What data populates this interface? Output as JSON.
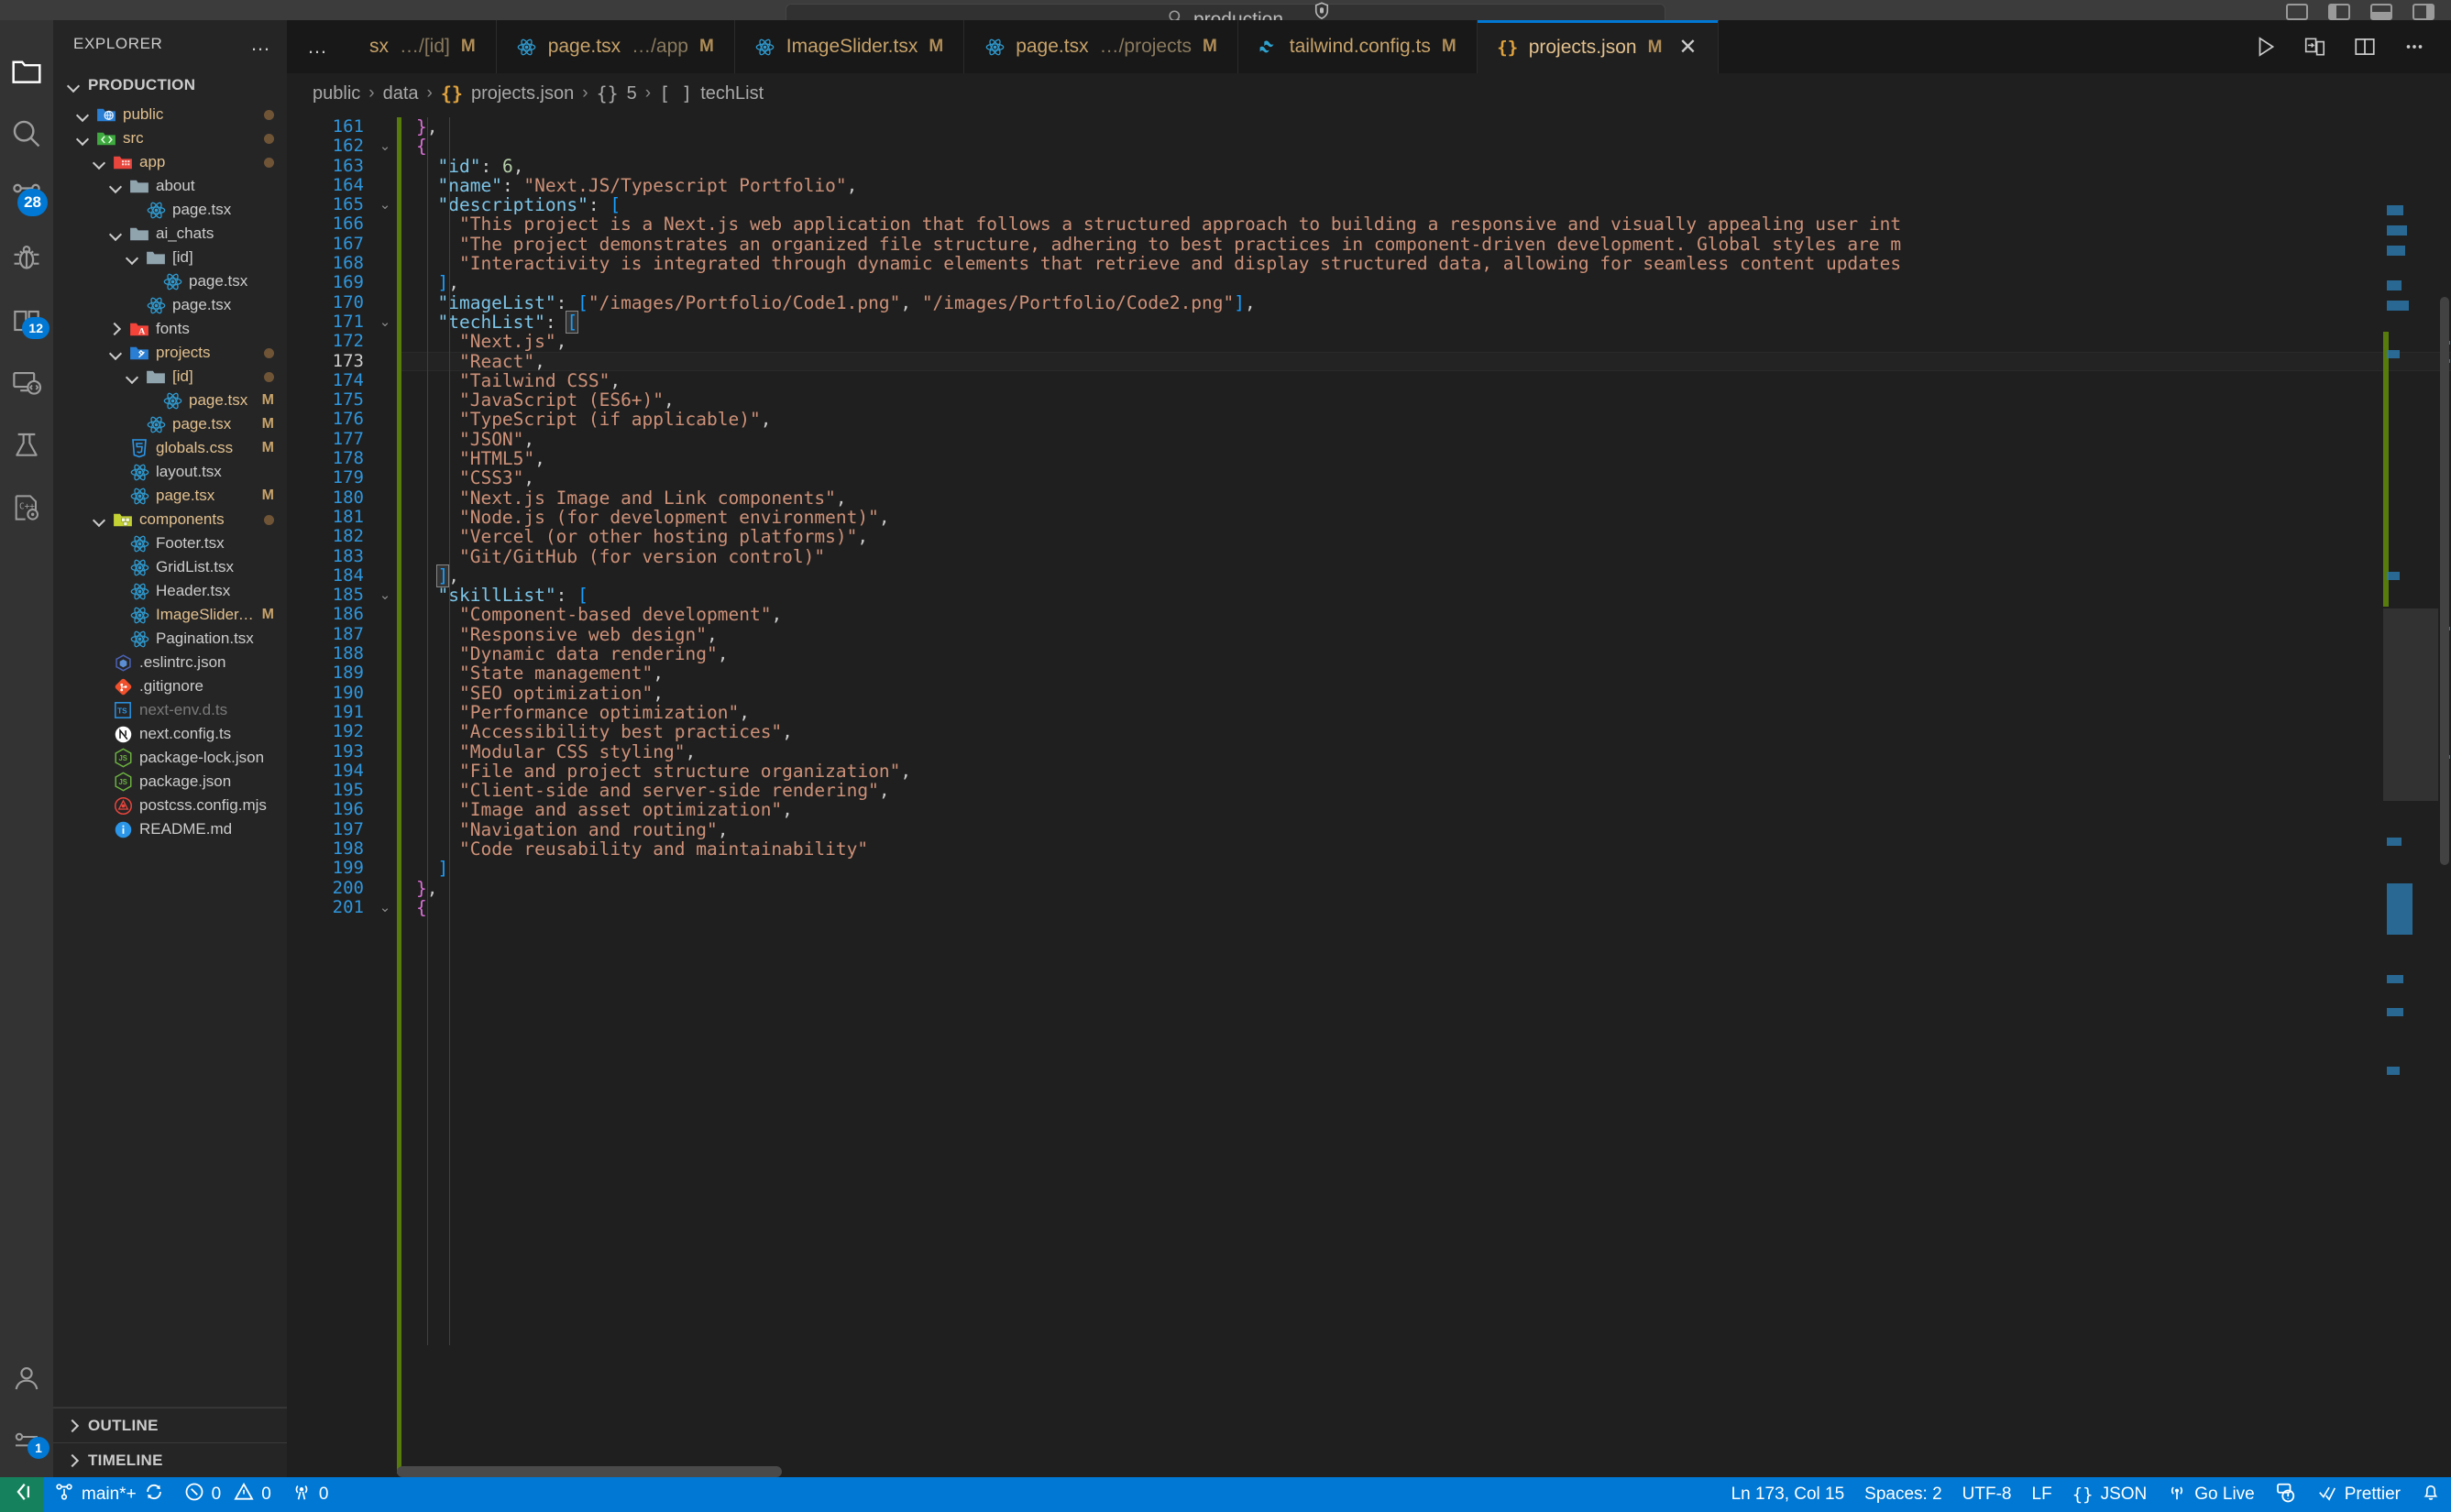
{
  "titlebar": {
    "search_value": "production",
    "search_icon": "search-icon",
    "shield_icon": "shield-icon",
    "window_controls": [
      "split-editor-icon",
      "panel-left-icon",
      "panel-bottom-icon",
      "panel-right-icon"
    ]
  },
  "activitybar": {
    "items": [
      {
        "name": "explorer",
        "icon": "files-explorer-icon",
        "badge": ""
      },
      {
        "name": "search",
        "icon": "search-icon",
        "badge": ""
      },
      {
        "name": "source-control",
        "icon": "source-control-icon",
        "badge": "28"
      },
      {
        "name": "run-and-debug",
        "icon": "debug-icon",
        "badge": ""
      },
      {
        "name": "extensions",
        "icon": "extensions-icon",
        "badge": "12"
      },
      {
        "name": "remote-explorer",
        "icon": "remote-explorer-icon",
        "badge": ""
      },
      {
        "name": "testing",
        "icon": "beaker-icon",
        "badge": ""
      },
      {
        "name": "cpp-config",
        "icon": "cpp-gear-icon",
        "badge": ""
      }
    ],
    "bottom": [
      {
        "name": "accounts",
        "icon": "account-icon",
        "badge": ""
      },
      {
        "name": "manage",
        "icon": "gear-icon",
        "badge": "1"
      }
    ]
  },
  "sidebar": {
    "title": "EXPLORER",
    "more_actions": "…",
    "root_section": "PRODUCTION",
    "tree": [
      {
        "label": "public",
        "indent": 1,
        "type": "folder",
        "icon": "folder-public-icon",
        "arrow": "down",
        "status": "",
        "dot": true,
        "color": "mod"
      },
      {
        "label": "src",
        "indent": 1,
        "type": "folder",
        "icon": "folder-src-icon",
        "arrow": "down",
        "status": "",
        "dot": true,
        "color": "mod"
      },
      {
        "label": "app",
        "indent": 2,
        "type": "folder",
        "icon": "folder-app-icon",
        "arrow": "down",
        "status": "",
        "dot": true,
        "color": "mod"
      },
      {
        "label": "about",
        "indent": 3,
        "type": "folder",
        "icon": "folder-icon",
        "arrow": "down",
        "status": "",
        "dot": false,
        "color": ""
      },
      {
        "label": "page.tsx",
        "indent": 4,
        "type": "file",
        "icon": "react-icon",
        "arrow": "",
        "status": "",
        "dot": false,
        "color": ""
      },
      {
        "label": "ai_chats",
        "indent": 3,
        "type": "folder",
        "icon": "folder-icon",
        "arrow": "down",
        "status": "",
        "dot": false,
        "color": ""
      },
      {
        "label": "[id]",
        "indent": 4,
        "type": "folder",
        "icon": "folder-icon",
        "arrow": "down",
        "status": "",
        "dot": false,
        "color": ""
      },
      {
        "label": "page.tsx",
        "indent": 5,
        "type": "file",
        "icon": "react-icon",
        "arrow": "",
        "status": "",
        "dot": false,
        "color": ""
      },
      {
        "label": "page.tsx",
        "indent": 4,
        "type": "file",
        "icon": "react-icon",
        "arrow": "",
        "status": "",
        "dot": false,
        "color": ""
      },
      {
        "label": "fonts",
        "indent": 3,
        "type": "folder",
        "icon": "folder-fonts-icon",
        "arrow": "right",
        "status": "",
        "dot": false,
        "color": ""
      },
      {
        "label": "projects",
        "indent": 3,
        "type": "folder",
        "icon": "folder-projects-icon",
        "arrow": "down",
        "status": "",
        "dot": true,
        "color": "mod"
      },
      {
        "label": "[id]",
        "indent": 4,
        "type": "folder",
        "icon": "folder-icon",
        "arrow": "down",
        "status": "",
        "dot": true,
        "color": "mod"
      },
      {
        "label": "page.tsx",
        "indent": 5,
        "type": "file",
        "icon": "react-icon",
        "arrow": "",
        "status": "M",
        "dot": false,
        "color": "mod"
      },
      {
        "label": "page.tsx",
        "indent": 4,
        "type": "file",
        "icon": "react-icon",
        "arrow": "",
        "status": "M",
        "dot": false,
        "color": "mod"
      },
      {
        "label": "globals.css",
        "indent": 3,
        "type": "file",
        "icon": "css-icon",
        "arrow": "",
        "status": "M",
        "dot": false,
        "color": "mod"
      },
      {
        "label": "layout.tsx",
        "indent": 3,
        "type": "file",
        "icon": "react-icon",
        "arrow": "",
        "status": "",
        "dot": false,
        "color": ""
      },
      {
        "label": "page.tsx",
        "indent": 3,
        "type": "file",
        "icon": "react-icon",
        "arrow": "",
        "status": "M",
        "dot": false,
        "color": "mod"
      },
      {
        "label": "components",
        "indent": 2,
        "type": "folder",
        "icon": "folder-components-icon",
        "arrow": "down",
        "status": "",
        "dot": true,
        "color": "mod"
      },
      {
        "label": "Footer.tsx",
        "indent": 3,
        "type": "file",
        "icon": "react-icon",
        "arrow": "",
        "status": "",
        "dot": false,
        "color": ""
      },
      {
        "label": "GridList.tsx",
        "indent": 3,
        "type": "file",
        "icon": "react-icon",
        "arrow": "",
        "status": "",
        "dot": false,
        "color": ""
      },
      {
        "label": "Header.tsx",
        "indent": 3,
        "type": "file",
        "icon": "react-icon",
        "arrow": "",
        "status": "",
        "dot": false,
        "color": ""
      },
      {
        "label": "ImageSlider.tsx",
        "indent": 3,
        "type": "file",
        "icon": "react-icon",
        "arrow": "",
        "status": "M",
        "dot": false,
        "color": "mod"
      },
      {
        "label": "Pagination.tsx",
        "indent": 3,
        "type": "file",
        "icon": "react-icon",
        "arrow": "",
        "status": "",
        "dot": false,
        "color": ""
      },
      {
        "label": ".eslintrc.json",
        "indent": 2,
        "type": "file",
        "icon": "eslint-icon",
        "arrow": "",
        "status": "",
        "dot": false,
        "color": ""
      },
      {
        "label": ".gitignore",
        "indent": 2,
        "type": "file",
        "icon": "git-icon",
        "arrow": "",
        "status": "",
        "dot": false,
        "color": ""
      },
      {
        "label": "next-env.d.ts",
        "indent": 2,
        "type": "file",
        "icon": "typescript-def-icon",
        "arrow": "",
        "status": "",
        "dot": false,
        "color": "dim"
      },
      {
        "label": "next.config.ts",
        "indent": 2,
        "type": "file",
        "icon": "nextjs-icon",
        "arrow": "",
        "status": "",
        "dot": false,
        "color": ""
      },
      {
        "label": "package-lock.json",
        "indent": 2,
        "type": "file",
        "icon": "npm-json-icon",
        "arrow": "",
        "status": "",
        "dot": false,
        "color": ""
      },
      {
        "label": "package.json",
        "indent": 2,
        "type": "file",
        "icon": "npm-json-icon",
        "arrow": "",
        "status": "",
        "dot": false,
        "color": ""
      },
      {
        "label": "postcss.config.mjs",
        "indent": 2,
        "type": "file",
        "icon": "postcss-icon",
        "arrow": "",
        "status": "",
        "dot": false,
        "color": ""
      },
      {
        "label": "README.md",
        "indent": 2,
        "type": "file",
        "icon": "info-markdown-icon",
        "arrow": "",
        "status": "",
        "dot": false,
        "color": ""
      }
    ],
    "footer_sections": [
      "OUTLINE",
      "TIMELINE"
    ]
  },
  "tabs": {
    "leading_overflow": "…",
    "items": [
      {
        "label": "sx",
        "sub": "…/[id]",
        "status": "M",
        "icon": "",
        "active": false,
        "clipped": true
      },
      {
        "label": "page.tsx",
        "sub": "…/app",
        "status": "M",
        "icon": "react-icon",
        "active": false,
        "clipped": false
      },
      {
        "label": "ImageSlider.tsx",
        "sub": "",
        "status": "M",
        "icon": "react-icon",
        "active": false,
        "clipped": false
      },
      {
        "label": "page.tsx",
        "sub": "…/projects",
        "status": "M",
        "icon": "react-icon",
        "active": false,
        "clipped": false
      },
      {
        "label": "tailwind.config.ts",
        "sub": "",
        "status": "M",
        "icon": "tailwind-icon",
        "active": false,
        "clipped": false
      },
      {
        "label": "projects.json",
        "sub": "",
        "status": "M",
        "icon": "json-icon",
        "active": true,
        "clipped": false
      }
    ],
    "actions": [
      "run-play-icon",
      "split-run-icon",
      "split-editor-icon",
      "more-actions-icon"
    ]
  },
  "breadcrumb": {
    "parts": [
      {
        "text": "public",
        "icon": ""
      },
      {
        "text": "data",
        "icon": ""
      },
      {
        "text": "projects.json",
        "icon": "json-icon"
      },
      {
        "text": "5",
        "icon": "object-icon"
      },
      {
        "text": "techList",
        "icon": "array-icon"
      }
    ],
    "separator": "›"
  },
  "code": {
    "first_line_number": 161,
    "language": "JSON",
    "current_line": 173,
    "lines": [
      {
        "n": 161,
        "fold": "",
        "indentGuides": 0,
        "html": "<span class=\"brc\">}</span><span class=\"p\">,</span>"
      },
      {
        "n": 162,
        "fold": "v",
        "indentGuides": 0,
        "html": "<span class=\"brc\">{</span>"
      },
      {
        "n": 163,
        "fold": "",
        "indentGuides": 1,
        "html": "  <span class=\"k\">\"id\"</span><span class=\"p\">: </span><span class=\"n\">6</span><span class=\"p\">,</span>"
      },
      {
        "n": 164,
        "fold": "",
        "indentGuides": 1,
        "html": "  <span class=\"k\">\"name\"</span><span class=\"p\">: </span><span class=\"s\">\"Next.JS/Typescript Portfolio\"</span><span class=\"p\">,</span>"
      },
      {
        "n": 165,
        "fold": "v",
        "indentGuides": 1,
        "html": "  <span class=\"k\">\"descriptions\"</span><span class=\"p\">: </span><span class=\"brs\">[</span>"
      },
      {
        "n": 166,
        "fold": "",
        "indentGuides": 2,
        "html": "    <span class=\"s\">\"This project is a Next.js web application that follows a structured approach to building a responsive and visually appealing user int</span>"
      },
      {
        "n": 167,
        "fold": "",
        "indentGuides": 2,
        "html": "    <span class=\"s\">\"The project demonstrates an organized file structure, adhering to best practices in component-driven development. Global styles are m</span>"
      },
      {
        "n": 168,
        "fold": "",
        "indentGuides": 2,
        "html": "    <span class=\"s\">\"Interactivity is integrated through dynamic elements that retrieve and display structured data, allowing for seamless content updates</span>"
      },
      {
        "n": 169,
        "fold": "",
        "indentGuides": 1,
        "html": "  <span class=\"brs\">]</span><span class=\"p\">,</span>"
      },
      {
        "n": 170,
        "fold": "",
        "indentGuides": 1,
        "html": "  <span class=\"k\">\"imageList\"</span><span class=\"p\">: </span><span class=\"brs\">[</span><span class=\"s\">\"/images/Portfolio/Code1.png\"</span><span class=\"p\">, </span><span class=\"s\">\"/images/Portfolio/Code2.png\"</span><span class=\"brs\">]</span><span class=\"p\">,</span>"
      },
      {
        "n": 171,
        "fold": "v",
        "indentGuides": 1,
        "html": "  <span class=\"k\">\"techList\"</span><span class=\"p\">: </span><span class=\"brs match\">[</span>"
      },
      {
        "n": 172,
        "fold": "",
        "indentGuides": 2,
        "html": "    <span class=\"s\">\"Next.js\"</span><span class=\"p\">,</span>"
      },
      {
        "n": 173,
        "fold": "",
        "indentGuides": 2,
        "html": "    <span class=\"s\">\"React\"</span><span class=\"p\">,</span>"
      },
      {
        "n": 174,
        "fold": "",
        "indentGuides": 2,
        "html": "    <span class=\"s\">\"Tailwind CSS\"</span><span class=\"p\">,</span>"
      },
      {
        "n": 175,
        "fold": "",
        "indentGuides": 2,
        "html": "    <span class=\"s\">\"JavaScript (ES6+)\"</span><span class=\"p\">,</span>"
      },
      {
        "n": 176,
        "fold": "",
        "indentGuides": 2,
        "html": "    <span class=\"s\">\"TypeScript (if applicable)\"</span><span class=\"p\">,</span>"
      },
      {
        "n": 177,
        "fold": "",
        "indentGuides": 2,
        "html": "    <span class=\"s\">\"JSON\"</span><span class=\"p\">,</span>"
      },
      {
        "n": 178,
        "fold": "",
        "indentGuides": 2,
        "html": "    <span class=\"s\">\"HTML5\"</span><span class=\"p\">,</span>"
      },
      {
        "n": 179,
        "fold": "",
        "indentGuides": 2,
        "html": "    <span class=\"s\">\"CSS3\"</span><span class=\"p\">,</span>"
      },
      {
        "n": 180,
        "fold": "",
        "indentGuides": 2,
        "html": "    <span class=\"s\">\"Next.js Image and Link components\"</span><span class=\"p\">,</span>"
      },
      {
        "n": 181,
        "fold": "",
        "indentGuides": 2,
        "html": "    <span class=\"s\">\"Node.js (for development environment)\"</span><span class=\"p\">,</span>"
      },
      {
        "n": 182,
        "fold": "",
        "indentGuides": 2,
        "html": "    <span class=\"s\">\"Vercel (or other hosting platforms)\"</span><span class=\"p\">,</span>"
      },
      {
        "n": 183,
        "fold": "",
        "indentGuides": 2,
        "html": "    <span class=\"s\">\"Git/GitHub (for version control)\"</span>"
      },
      {
        "n": 184,
        "fold": "",
        "indentGuides": 1,
        "html": "  <span class=\"brs match\">]</span><span class=\"p\">,</span>"
      },
      {
        "n": 185,
        "fold": "v",
        "indentGuides": 1,
        "html": "  <span class=\"k\">\"skillList\"</span><span class=\"p\">: </span><span class=\"brs\">[</span>"
      },
      {
        "n": 186,
        "fold": "",
        "indentGuides": 2,
        "html": "    <span class=\"s\">\"Component-based development\"</span><span class=\"p\">,</span>"
      },
      {
        "n": 187,
        "fold": "",
        "indentGuides": 2,
        "html": "    <span class=\"s\">\"Responsive web design\"</span><span class=\"p\">,</span>"
      },
      {
        "n": 188,
        "fold": "",
        "indentGuides": 2,
        "html": "    <span class=\"s\">\"Dynamic data rendering\"</span><span class=\"p\">,</span>"
      },
      {
        "n": 189,
        "fold": "",
        "indentGuides": 2,
        "html": "    <span class=\"s\">\"State management\"</span><span class=\"p\">,</span>"
      },
      {
        "n": 190,
        "fold": "",
        "indentGuides": 2,
        "html": "    <span class=\"s\">\"SEO optimization\"</span><span class=\"p\">,</span>"
      },
      {
        "n": 191,
        "fold": "",
        "indentGuides": 2,
        "html": "    <span class=\"s\">\"Performance optimization\"</span><span class=\"p\">,</span>"
      },
      {
        "n": 192,
        "fold": "",
        "indentGuides": 2,
        "html": "    <span class=\"s\">\"Accessibility best practices\"</span><span class=\"p\">,</span>"
      },
      {
        "n": 193,
        "fold": "",
        "indentGuides": 2,
        "html": "    <span class=\"s\">\"Modular CSS styling\"</span><span class=\"p\">,</span>"
      },
      {
        "n": 194,
        "fold": "",
        "indentGuides": 2,
        "html": "    <span class=\"s\">\"File and project structure organization\"</span><span class=\"p\">,</span>"
      },
      {
        "n": 195,
        "fold": "",
        "indentGuides": 2,
        "html": "    <span class=\"s\">\"Client-side and server-side rendering\"</span><span class=\"p\">,</span>"
      },
      {
        "n": 196,
        "fold": "",
        "indentGuides": 2,
        "html": "    <span class=\"s\">\"Image and asset optimization\"</span><span class=\"p\">,</span>"
      },
      {
        "n": 197,
        "fold": "",
        "indentGuides": 2,
        "html": "    <span class=\"s\">\"Navigation and routing\"</span><span class=\"p\">,</span>"
      },
      {
        "n": 198,
        "fold": "",
        "indentGuides": 2,
        "html": "    <span class=\"s\">\"Code reusability and maintainability\"</span>"
      },
      {
        "n": 199,
        "fold": "",
        "indentGuides": 1,
        "html": "  <span class=\"brs\">]</span>"
      },
      {
        "n": 200,
        "fold": "",
        "indentGuides": 0,
        "html": "<span class=\"brc\">}</span><span class=\"p\">,</span>"
      },
      {
        "n": 201,
        "fold": "v",
        "indentGuides": 0,
        "html": "<span class=\"brc\">{</span>"
      }
    ]
  },
  "statusbar": {
    "remote_icon": "remote-window-icon",
    "branch_icon": "source-control-icon",
    "branch": "main*+",
    "sync_icon": "sync-icon",
    "error_icon": "error-icon",
    "errors": "0",
    "warning_icon": "warning-icon",
    "warnings": "0",
    "ports_icon": "radio-tower-icon",
    "ports": "0",
    "cursor": "Ln 173, Col 15",
    "indentation": "Spaces: 2",
    "encoding": "UTF-8",
    "eol": "LF",
    "language_icon": "json-icon",
    "language": "JSON",
    "golive_icon": "broadcast-icon",
    "golive": "Go Live",
    "remote_status_icon": "remote-host-icon",
    "prettier_icon": "check-icon",
    "prettier": "Prettier",
    "bell_icon": "bell-icon"
  },
  "colors": {
    "accent": "#0078d4",
    "remote_green": "#16825d",
    "string": "#ce9178",
    "key": "#7cc5e8",
    "number": "#b5cea8",
    "modified": "#e2c08d",
    "gutter_blue": "#2f96dc",
    "change_bar_green": "#587c0c"
  }
}
